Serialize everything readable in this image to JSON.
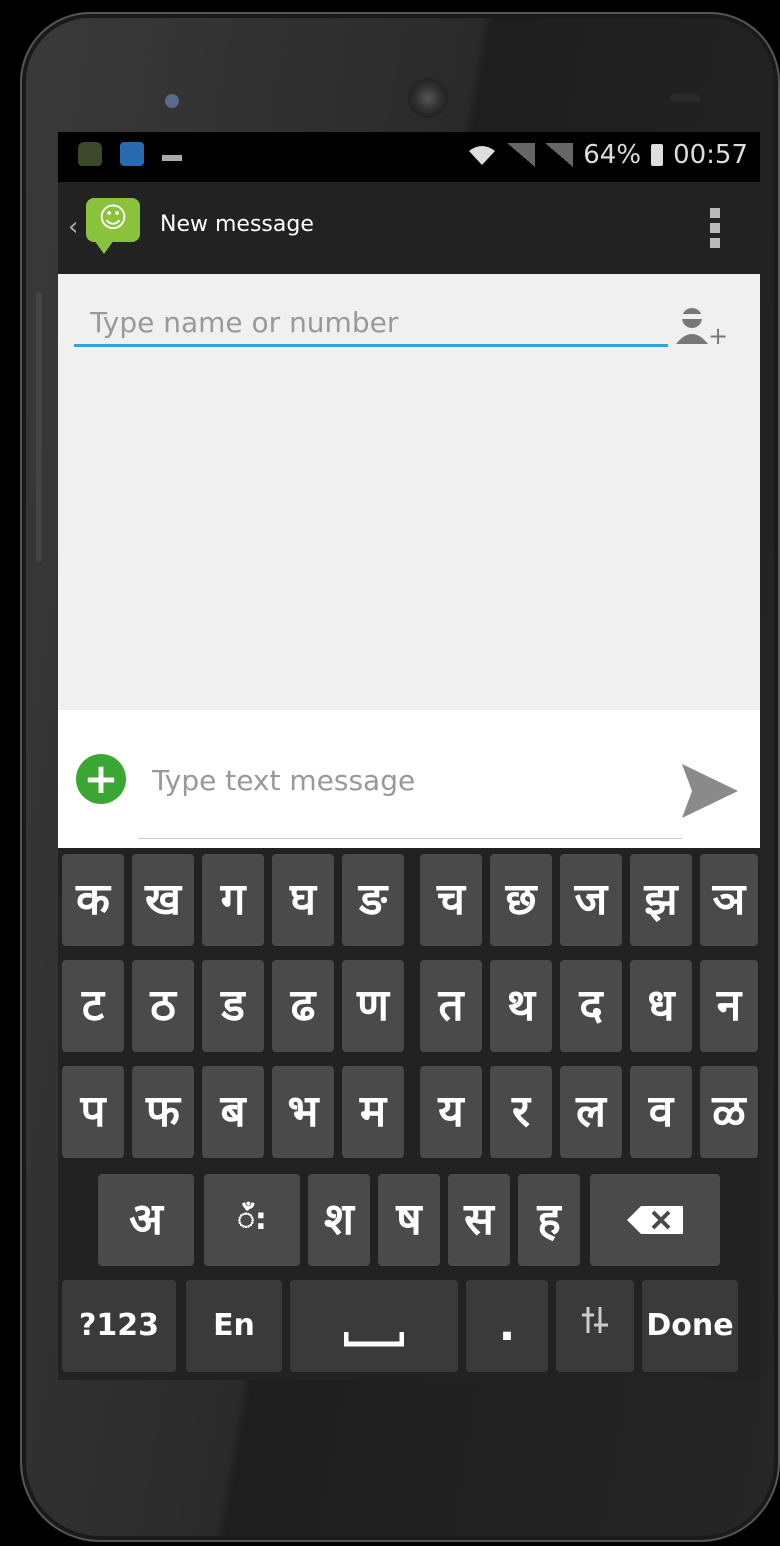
{
  "status_bar": {
    "battery": "64%",
    "time": "00:57"
  },
  "action_bar": {
    "title": "New message"
  },
  "recipient": {
    "placeholder": "Type name or number"
  },
  "message": {
    "placeholder": "Type text message"
  },
  "keyboard": {
    "row1": [
      "क",
      "ख",
      "ग",
      "घ",
      "ङ",
      "च",
      "छ",
      "ज",
      "झ",
      "ञ"
    ],
    "row2": [
      "ट",
      "ठ",
      "ड",
      "ढ",
      "ण",
      "त",
      "थ",
      "द",
      "ध",
      "न"
    ],
    "row3": [
      "प",
      "फ",
      "ब",
      "भ",
      "म",
      "य",
      "र",
      "ल",
      "व",
      "ळ"
    ],
    "row4": [
      "अ",
      "ँं:",
      "श",
      "ष",
      "स",
      "ह"
    ],
    "bottom": {
      "symbols": "?123",
      "lang": "En",
      "period": ".",
      "done": "Done"
    }
  },
  "colors": {
    "accent": "#33a3d9",
    "app_green": "#8bc23b",
    "attach_green": "#3aa634"
  }
}
